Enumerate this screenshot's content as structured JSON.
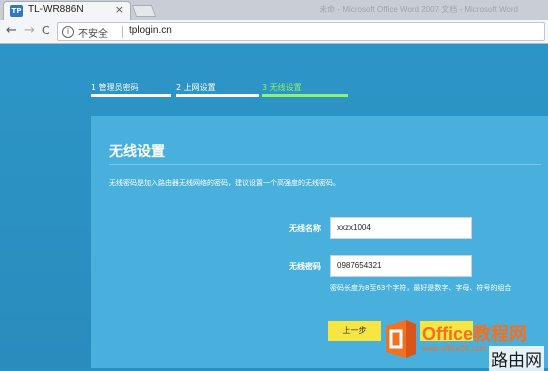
{
  "browser": {
    "tab_title": "TL-WR886N",
    "tab_close": "×",
    "favicon_text": "TP",
    "background_window_title": "未命 - Microsoft Office Word 2007 文档 - Microsoft Word",
    "back": "←",
    "forward": "→",
    "reload": "C",
    "info_icon": "i",
    "security_label": "不安全",
    "url": "tplogin.cn"
  },
  "steps": [
    {
      "label": "1 管理员密码",
      "state": "done"
    },
    {
      "label": "2 上网设置",
      "state": "done"
    },
    {
      "label": "3 无线设置",
      "state": "active"
    }
  ],
  "panel": {
    "title": "无线设置",
    "description": "无线密码是加入路由器无线网络的密码，建议设置一个高强度的无线密码。",
    "ssid_label": "无线名称",
    "ssid_value": "xxzx1004",
    "password_label": "无线密码",
    "password_value": "0987654321",
    "hint": "密码长度为8至63个字符，最好是数字、字母、符号的组合",
    "prev_button": "上一步"
  },
  "watermark": {
    "brand": "Office教程网",
    "url": "www.office26.com",
    "site": "路由网"
  },
  "colors": {
    "page_bg": "#2a8fc1",
    "panel_bg": "#49b0dd",
    "active_step": "#8df36d",
    "button": "#f7e542",
    "brand_orange": "#f37021"
  }
}
